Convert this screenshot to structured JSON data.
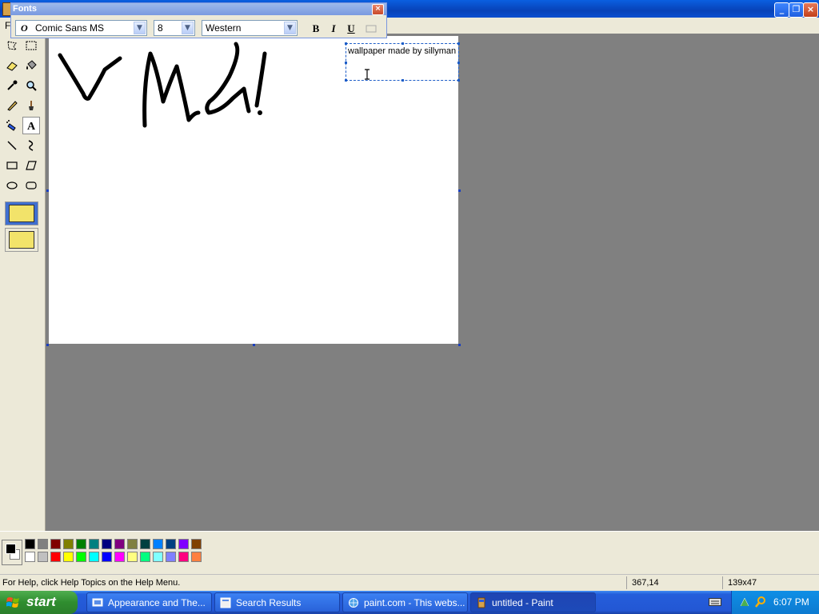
{
  "window": {
    "title": "untitled - Paint",
    "menu_first_letter": "F",
    "buttons": [
      "minimize",
      "maximize",
      "close"
    ]
  },
  "fonts_toolbar": {
    "title": "Fonts",
    "font_name": "Comic Sans MS",
    "font_size": "8",
    "script": "Western",
    "bold_label": "B",
    "italic_label": "I",
    "underline_label": "U"
  },
  "canvas": {
    "drawn_text": "V Ma!",
    "text_box_content": "wallpaper made by sillyman"
  },
  "tools": [
    "free-form-select-icon",
    "select-icon",
    "eraser-icon",
    "fill-icon",
    "pick-color-icon",
    "magnifier-icon",
    "pencil-icon",
    "brush-icon",
    "airbrush-icon",
    "text-icon",
    "line-icon",
    "curve-icon",
    "rectangle-icon",
    "polygon-icon",
    "ellipse-icon",
    "rounded-rectangle-icon"
  ],
  "palette": {
    "foreground": "#000000",
    "background": "#ffffff",
    "row1": [
      "#000000",
      "#808080",
      "#800000",
      "#808000",
      "#008000",
      "#008080",
      "#000080",
      "#800080",
      "#808040",
      "#004040",
      "#0080ff",
      "#004080",
      "#8000ff",
      "#804000"
    ],
    "row2": [
      "#ffffff",
      "#c0c0c0",
      "#ff0000",
      "#ffff00",
      "#00ff00",
      "#00ffff",
      "#0000ff",
      "#ff00ff",
      "#ffff80",
      "#00ff80",
      "#80ffff",
      "#8080ff",
      "#ff0080",
      "#ff8040"
    ]
  },
  "statusbar": {
    "help": "For Help, click Help Topics on the Help Menu.",
    "cursor": "367,14",
    "size": "139x47"
  },
  "taskbar": {
    "start": "start",
    "tasks": [
      {
        "label": "Appearance and The..."
      },
      {
        "label": "Search Results"
      },
      {
        "label": "paint.com - This webs..."
      },
      {
        "label": "untitled - Paint"
      }
    ],
    "clock": "6:07 PM"
  }
}
